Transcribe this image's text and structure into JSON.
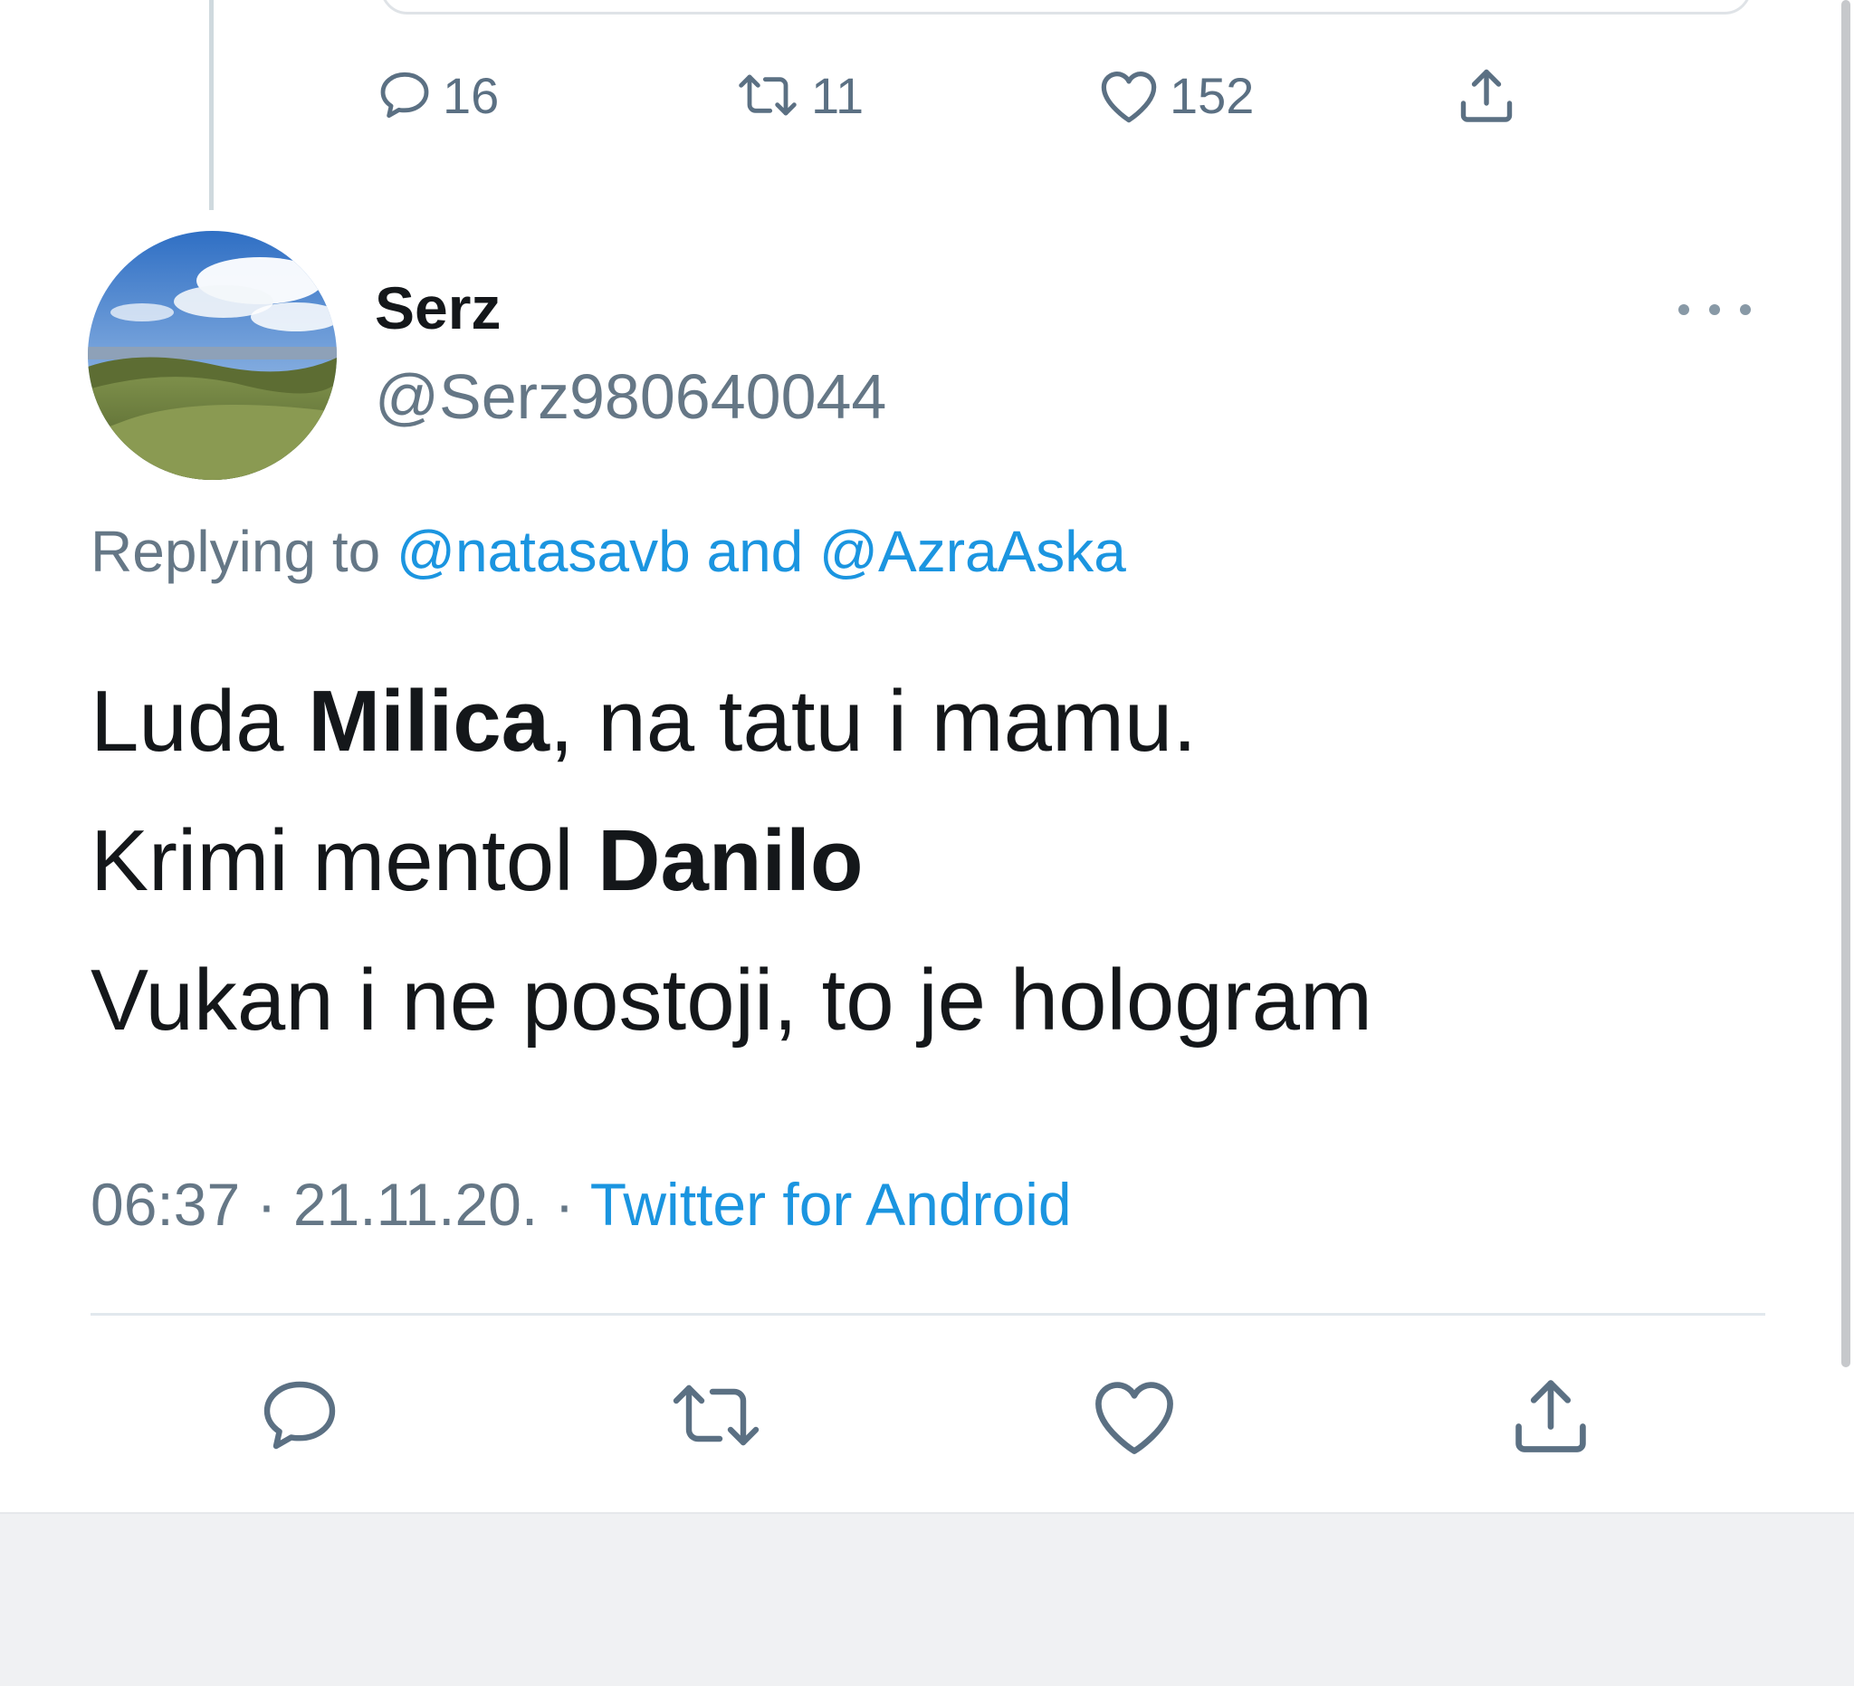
{
  "previous_tweet": {
    "actions": {
      "reply_count": "16",
      "retweet_count": "11",
      "like_count": "152"
    }
  },
  "tweet": {
    "author": {
      "display_name": "Serz",
      "handle": "@Serz980640044"
    },
    "replying_to": {
      "prefix": "Replying to",
      "user1": "@natasavb",
      "conjunction": "and",
      "user2": "@AzraAska"
    },
    "lines": [
      {
        "pre": "Luda ",
        "bold": "Milica",
        "post": ", na tatu i mamu."
      },
      {
        "pre": "Krimi mentol ",
        "bold": "Danilo",
        "post": ""
      },
      {
        "pre": "Vukan i ne postoji, to je hologram",
        "bold": "",
        "post": ""
      }
    ],
    "meta": {
      "time": "06:37",
      "date": "21.11.20.",
      "separator": "·",
      "source": "Twitter for Android"
    }
  },
  "icons": {
    "reply": "reply-icon",
    "retweet": "retweet-icon",
    "like": "like-icon",
    "share": "share-icon",
    "more": "more-icon"
  },
  "colors": {
    "link": "#1b95e0",
    "secondary_text": "#657786",
    "icon_gray": "#5b7083"
  }
}
